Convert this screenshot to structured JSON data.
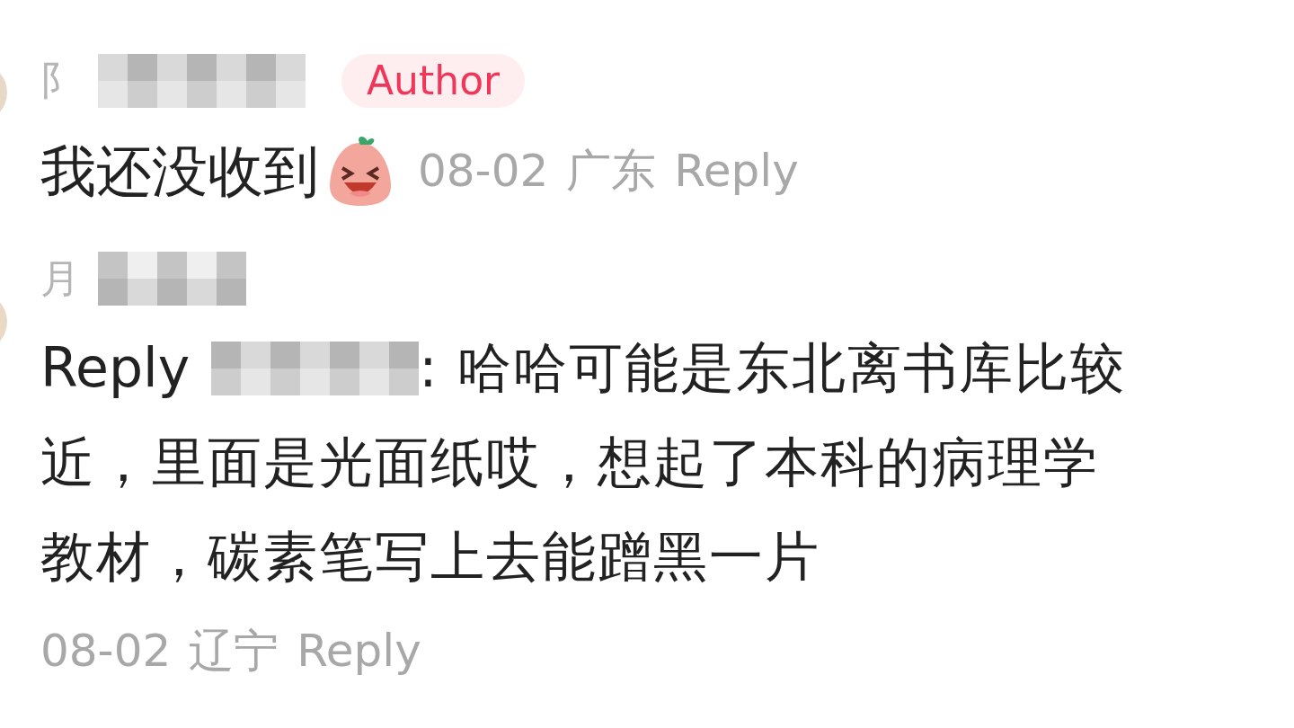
{
  "comments": [
    {
      "username": "阝",
      "badge": "Author",
      "text": "我还没收到",
      "emoji": true,
      "date": "08-02",
      "location": "广东",
      "reply_label": "Reply"
    },
    {
      "username": "月",
      "reply_prefix": "Reply",
      "text_lines": [
        ": 哈哈可能是东北离书库比较",
        "近，里面是光面纸哎，想起了本科的病理学",
        "教材，碳素笔写上去能蹭黑一片"
      ],
      "date": "08-02",
      "location": "辽宁",
      "reply_label": "Reply"
    }
  ]
}
